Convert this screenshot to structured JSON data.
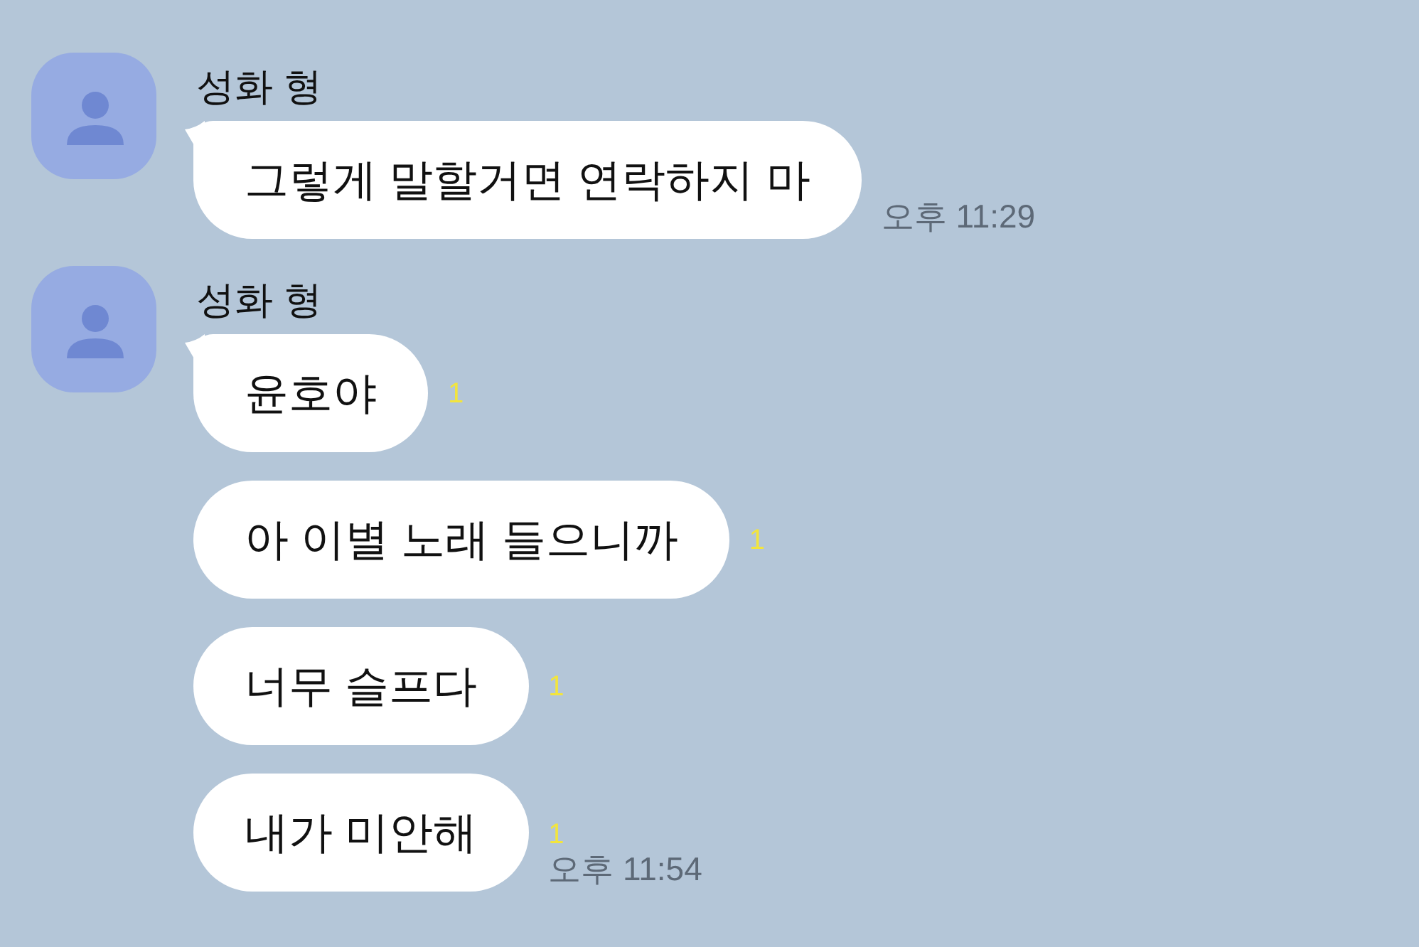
{
  "conversation": [
    {
      "sender": "성화 형",
      "messages": [
        {
          "text": "그렇게 말할거면 연락하지 마",
          "time": "오후 11:29"
        }
      ]
    },
    {
      "sender": "성화 형",
      "messages": [
        {
          "text": "윤호야",
          "unread": "1"
        },
        {
          "text": "아 이별 노래 들으니까",
          "unread": "1"
        },
        {
          "text": "너무 슬프다",
          "unread": "1"
        },
        {
          "text": "내가 미안해",
          "unread": "1",
          "time": "오후 11:54"
        }
      ]
    }
  ]
}
